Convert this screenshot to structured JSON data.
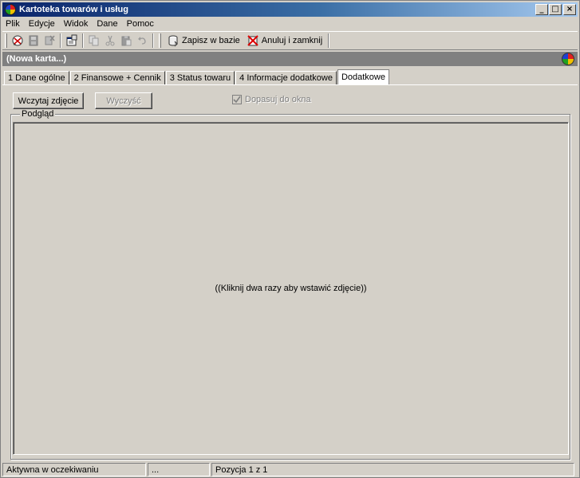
{
  "window": {
    "title": "Kartoteka towarów i usług",
    "minimize_glyph": "_",
    "maximize_glyph": "□",
    "close_glyph": "×"
  },
  "menu": {
    "items": [
      {
        "label": "Plik"
      },
      {
        "label": "Edycje"
      },
      {
        "label": "Widok"
      },
      {
        "label": "Dane"
      },
      {
        "label": "Pomoc"
      }
    ]
  },
  "toolbar": {
    "icons": [
      "new-record-icon",
      "save-icon",
      "delete-icon",
      "properties-icon",
      "copy-icon",
      "cut-icon",
      "paste-icon",
      "undo-icon"
    ],
    "save_label": "Zapisz w bazie",
    "cancel_label": "Anuluj i zamknij"
  },
  "card": {
    "title": "(Nowa karta...)"
  },
  "tabs": [
    {
      "label": "1 Dane ogólne"
    },
    {
      "label": "2 Finansowe + Cennik"
    },
    {
      "label": "3 Status towaru"
    },
    {
      "label": "4 Informacje dodatkowe"
    },
    {
      "label": "Dodatkowe",
      "active": true
    }
  ],
  "actions": {
    "load_photo_label": "Wczytaj zdjęcie",
    "clear_label": "Wyczyść",
    "fit_window_label": "Dopasuj do okna",
    "fit_window_checked": true
  },
  "preview": {
    "group_label": "Podgląd",
    "hint": "((Kliknij dwa razy aby wstawić zdjęcie))"
  },
  "status": {
    "state": "Aktywna w oczekiwaniu",
    "middle": "...",
    "position": "Pozycja 1 z 1"
  }
}
